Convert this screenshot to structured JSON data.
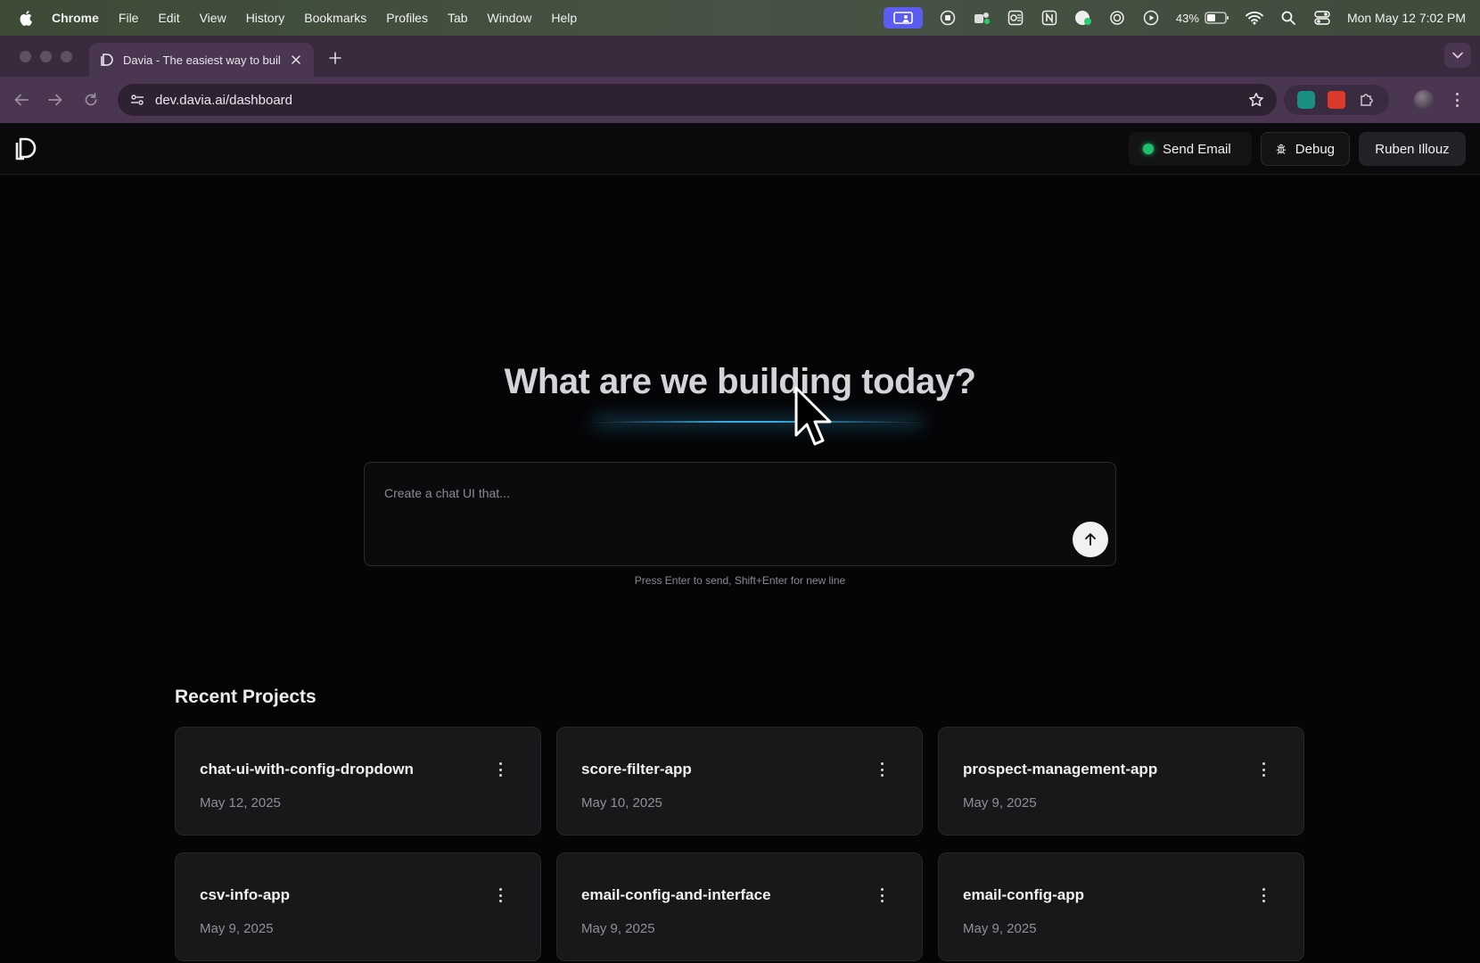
{
  "menubar": {
    "app_name": "Chrome",
    "items": [
      "File",
      "Edit",
      "View",
      "History",
      "Bookmarks",
      "Profiles",
      "Tab",
      "Window",
      "Help"
    ],
    "battery": "43%",
    "datetime": "Mon May 12  7:02 PM"
  },
  "browser": {
    "tab_title": "Davia - The easiest way to build",
    "url": "dev.davia.ai/dashboard"
  },
  "header": {
    "send_email_label": "Send Email",
    "debug_label": "Debug",
    "user_name": "Ruben Illouz",
    "status_color": "#1fc06a"
  },
  "hero": {
    "title": "What are we building today?",
    "prompt_placeholder": "Create a chat UI that...",
    "hint": "Press Enter to send, Shift+Enter for new line"
  },
  "recent": {
    "title": "Recent Projects",
    "projects": [
      {
        "name": "chat-ui-with-config-dropdown",
        "date": "May 12, 2025"
      },
      {
        "name": "score-filter-app",
        "date": "May 10, 2025"
      },
      {
        "name": "prospect-management-app",
        "date": "May 9, 2025"
      },
      {
        "name": "csv-info-app",
        "date": "May 9, 2025"
      },
      {
        "name": "email-config-and-interface",
        "date": "May 9, 2025"
      },
      {
        "name": "email-config-app",
        "date": "May 9, 2025"
      }
    ]
  }
}
